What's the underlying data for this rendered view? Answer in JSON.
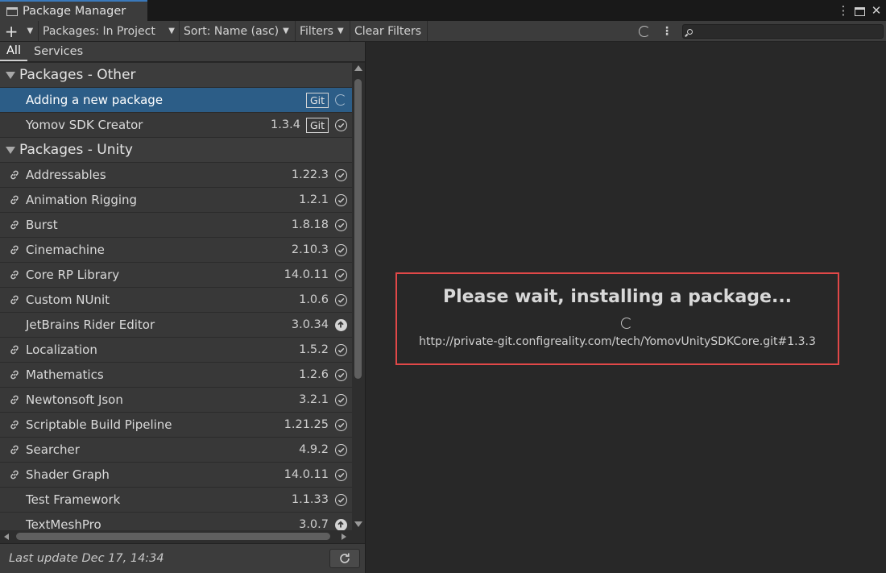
{
  "window": {
    "title": "Package Manager"
  },
  "toolbar": {
    "add_label": "+",
    "scope_label": "Packages: In Project",
    "sort_label": "Sort: Name (asc)",
    "filters_label": "Filters",
    "clear_filters_label": "Clear Filters",
    "search_value": ""
  },
  "tabs": [
    {
      "label": "All",
      "active": true
    },
    {
      "label": "Services",
      "active": false
    }
  ],
  "groups": {
    "other": {
      "title": "Packages - Other",
      "items": [
        {
          "name": "Adding a new package",
          "version": "",
          "git": "Git",
          "status": "loading",
          "linked": false,
          "selected": true
        },
        {
          "name": "Yomov SDK Creator",
          "version": "1.3.4",
          "git": "Git",
          "status": "installed",
          "linked": false,
          "selected": false
        }
      ]
    },
    "unity": {
      "title": "Packages - Unity",
      "items": [
        {
          "name": "Addressables",
          "version": "1.22.3",
          "status": "installed",
          "linked": true
        },
        {
          "name": "Animation Rigging",
          "version": "1.2.1",
          "status": "installed",
          "linked": true
        },
        {
          "name": "Burst",
          "version": "1.8.18",
          "status": "installed",
          "linked": true
        },
        {
          "name": "Cinemachine",
          "version": "2.10.3",
          "status": "installed",
          "linked": true
        },
        {
          "name": "Core RP Library",
          "version": "14.0.11",
          "status": "installed",
          "linked": true
        },
        {
          "name": "Custom NUnit",
          "version": "1.0.6",
          "status": "installed",
          "linked": true
        },
        {
          "name": "JetBrains Rider Editor",
          "version": "3.0.34",
          "status": "update",
          "linked": false
        },
        {
          "name": "Localization",
          "version": "1.5.2",
          "status": "installed",
          "linked": true
        },
        {
          "name": "Mathematics",
          "version": "1.2.6",
          "status": "installed",
          "linked": true
        },
        {
          "name": "Newtonsoft Json",
          "version": "3.2.1",
          "status": "installed",
          "linked": true
        },
        {
          "name": "Scriptable Build Pipeline",
          "version": "1.21.25",
          "status": "installed",
          "linked": true
        },
        {
          "name": "Searcher",
          "version": "4.9.2",
          "status": "installed",
          "linked": true
        },
        {
          "name": "Shader Graph",
          "version": "14.0.11",
          "status": "installed",
          "linked": true
        },
        {
          "name": "Test Framework",
          "version": "1.1.33",
          "status": "installed",
          "linked": false
        },
        {
          "name": "TextMeshPro",
          "version": "3.0.7",
          "status": "update",
          "linked": false
        }
      ]
    }
  },
  "footer": {
    "last_update": "Last update Dec 17, 14:34"
  },
  "detail": {
    "wait_title": "Please wait, installing a package...",
    "wait_url": "http://private-git.configreality.com/tech/YomovUnitySDKCore.git#1.3.3"
  },
  "colors": {
    "selection": "#2c5d87",
    "highlight_border": "#e14848",
    "tab_accent": "#3a79bb"
  }
}
